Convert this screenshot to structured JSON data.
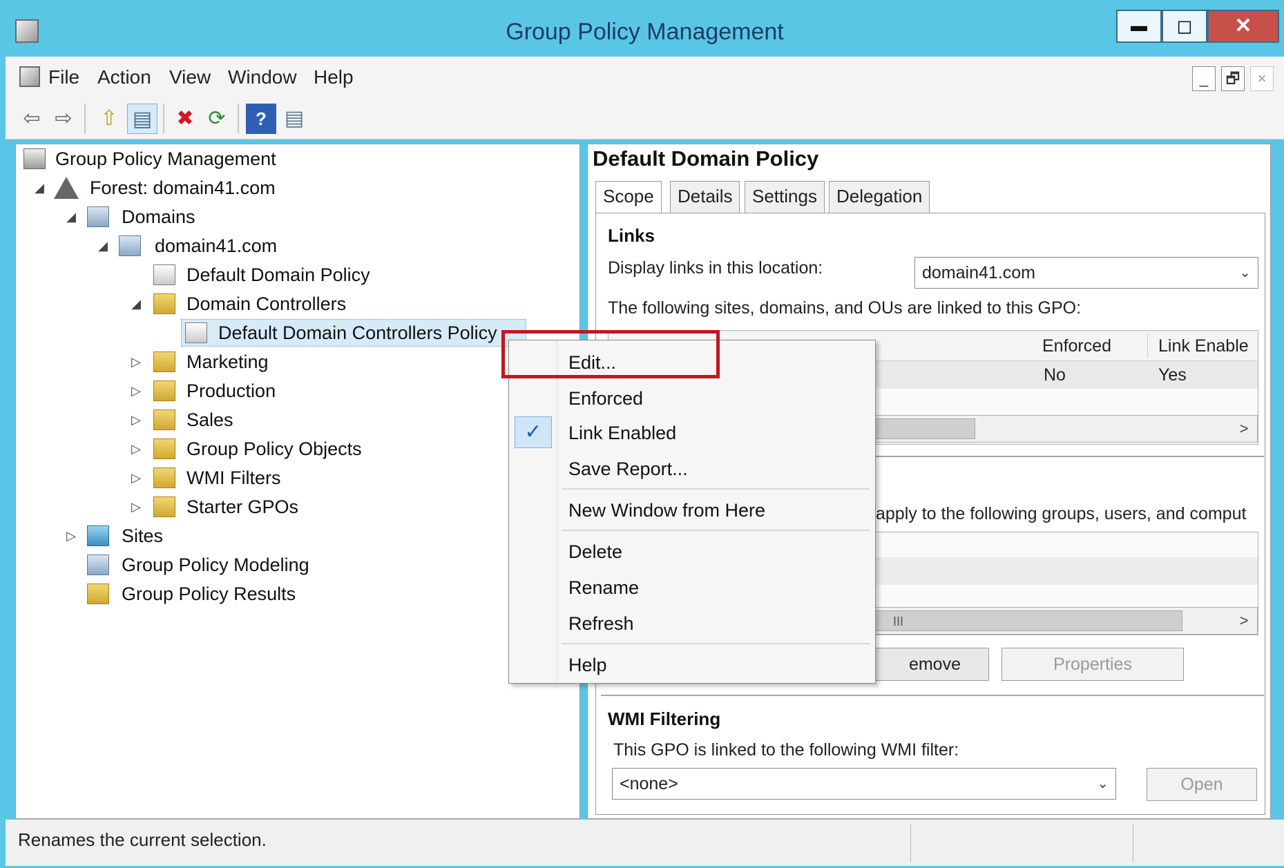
{
  "window": {
    "title": "Group Policy Management",
    "min_glyph": "▬",
    "max_glyph": "◻",
    "close_glyph": "✕"
  },
  "menubar": {
    "items": [
      "File",
      "Action",
      "View",
      "Window",
      "Help"
    ],
    "mdi_min": "_",
    "mdi_restore": "🗗",
    "mdi_close": "×"
  },
  "toolbar": {
    "back": "⇦",
    "forward": "⇨",
    "up": "⇧",
    "show_hide": "▤",
    "delete": "✖",
    "refresh": "⟳",
    "help": "?",
    "properties": "▤"
  },
  "tree": {
    "root": "Group Policy Management",
    "forest": "Forest: domain41.com",
    "domains": "Domains",
    "domain": "domain41.com",
    "default_domain_policy": "Default Domain Policy",
    "domain_controllers": "Domain Controllers",
    "default_dc_policy": "Default Domain Controllers Policy",
    "marketing": "Marketing",
    "production": "Production",
    "sales": "Sales",
    "gpo_objects": "Group Policy Objects",
    "wmi_filters": "WMI Filters",
    "starter_gpos": "Starter GPOs",
    "sites": "Sites",
    "modeling": "Group Policy Modeling",
    "results": "Group Policy Results",
    "expanded_glyph": "◢",
    "collapsed_glyph": "▷"
  },
  "right": {
    "title": "Default Domain Policy",
    "tabs": [
      "Scope",
      "Details",
      "Settings",
      "Delegation"
    ],
    "links_heading": "Links",
    "display_links_label": "Display links in this location:",
    "location_value": "domain41.com",
    "linked_text": "The following sites, domains, and OUs are linked to this GPO:",
    "columns": [
      "Enforced",
      "Link Enable"
    ],
    "row_values": [
      "No",
      "Yes"
    ],
    "security_text": "apply to the following groups, users, and comput",
    "scroll_marker": "III",
    "scroll_right": ">",
    "remove_fragment": "emove",
    "properties_button": "Properties",
    "wmi_heading": "WMI Filtering",
    "wmi_label": "This GPO is linked to the following WMI filter:",
    "wmi_value": "<none>",
    "open_button": "Open",
    "combo_arrow": "⌄"
  },
  "context_menu": {
    "edit": "Edit...",
    "enforced": "Enforced",
    "link_enabled": "Link Enabled",
    "save_report": "Save Report...",
    "new_window": "New Window from Here",
    "delete": "Delete",
    "rename": "Rename",
    "refresh": "Refresh",
    "help": "Help",
    "check_glyph": "✓"
  },
  "status": {
    "text": "Renames the current selection."
  },
  "colors": {
    "titlebar": "#5ac6e6",
    "close_button": "#c7504a",
    "highlight_border": "#c4161c",
    "selection": "#d7eaf8"
  }
}
